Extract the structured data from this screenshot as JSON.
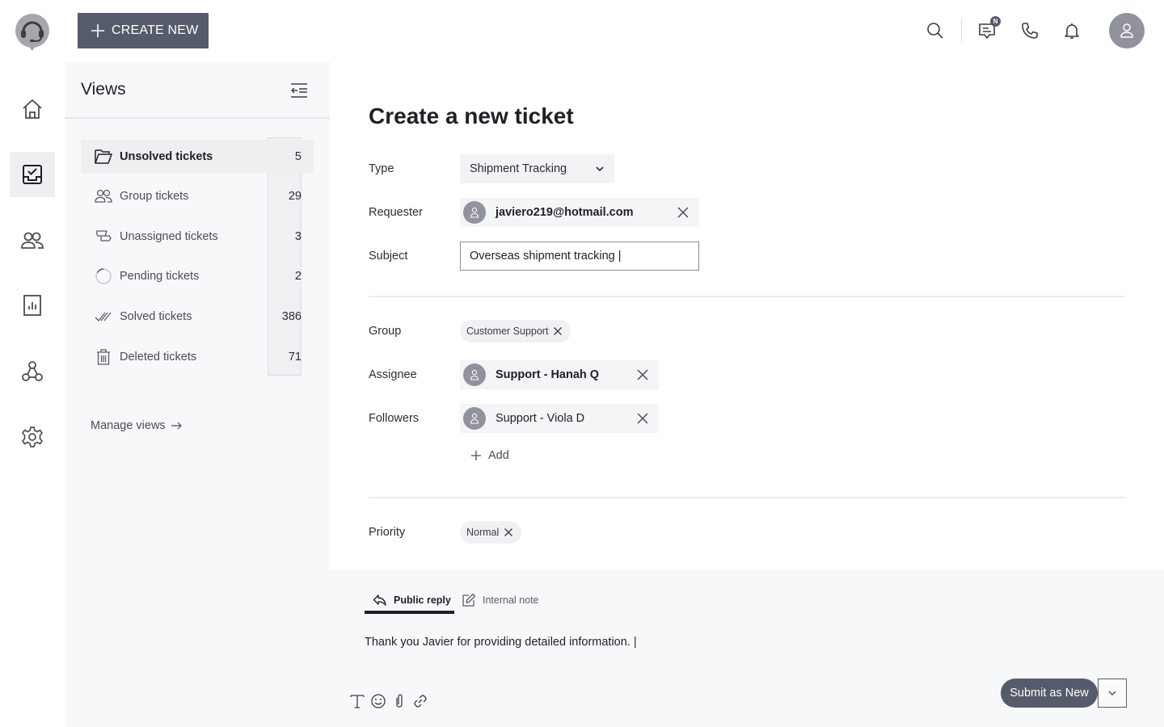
{
  "header": {
    "logo_icon": "headset-support-icon",
    "create_new_label": "CREATE NEW",
    "notification_badge": "N",
    "icons": [
      "search-icon",
      "chat-icon",
      "phone-icon",
      "bell-icon",
      "user-avatar-icon"
    ]
  },
  "rail": {
    "items": [
      {
        "name": "home",
        "icon": "home-icon",
        "active": false
      },
      {
        "name": "tickets",
        "icon": "inbox-check-icon",
        "active": true
      },
      {
        "name": "customers",
        "icon": "users-icon",
        "active": false
      },
      {
        "name": "reports",
        "icon": "bar-chart-icon",
        "active": false
      },
      {
        "name": "integrations",
        "icon": "nodes-icon",
        "active": false
      },
      {
        "name": "settings",
        "icon": "gear-icon",
        "active": false
      }
    ]
  },
  "views": {
    "title": "Views",
    "items": [
      {
        "label": "Unsolved tickets",
        "count": "5",
        "icon": "folder-open-icon",
        "active": true
      },
      {
        "label": "Group tickets",
        "count": "29",
        "icon": "users-icon",
        "active": false
      },
      {
        "label": "Unassigned tickets",
        "count": "3",
        "icon": "unassigned-icon",
        "active": false
      },
      {
        "label": "Pending tickets",
        "count": "2",
        "icon": "circle-pending-icon",
        "active": false
      },
      {
        "label": "Solved tickets",
        "count": "386",
        "icon": "double-check-icon",
        "active": false
      },
      {
        "label": "Deleted tickets",
        "count": "71",
        "icon": "trash-icon",
        "active": false
      }
    ],
    "manage_label": "Manage views"
  },
  "form": {
    "title": "Create a new ticket",
    "type": {
      "label": "Type",
      "value": "Shipment Tracking"
    },
    "requester": {
      "label": "Requester",
      "value": "javiero219@hotmail.com"
    },
    "subject": {
      "label": "Subject",
      "value": "Overseas shipment tracking |"
    },
    "group": {
      "label": "Group",
      "value": "Customer Support"
    },
    "assignee": {
      "label": "Assignee",
      "value": "Support - Hanah Q"
    },
    "followers": {
      "label": "Followers",
      "values": [
        "Support - Viola D"
      ],
      "add_label": "Add"
    },
    "priority": {
      "label": "Priority",
      "value": "Normal"
    }
  },
  "reply": {
    "tabs": [
      {
        "label": "Public reply",
        "active": true
      },
      {
        "label": "Internal note",
        "active": false
      }
    ],
    "text": "Thank you Javier for providing detailed information. |",
    "tools": [
      "text-format-icon",
      "emoji-icon",
      "attachment-icon",
      "link-icon"
    ],
    "submit_label": "Submit as New"
  },
  "colors": {
    "primary": "#565b6b",
    "avatar": "#91939c",
    "panel_bg": "#f7f8fa"
  }
}
